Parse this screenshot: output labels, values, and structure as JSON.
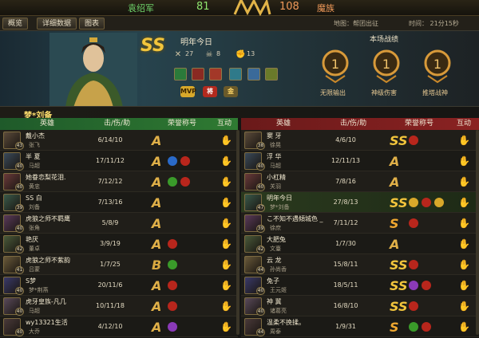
{
  "score": {
    "left_team": "袁绍军",
    "left_score": "81",
    "right_score": "108",
    "right_team": "魔族"
  },
  "tabs": [
    "概览",
    "详细数据",
    "图表"
  ],
  "map_info": "地图：帮团出征",
  "time_info": "时间：  21分15秒",
  "hero": {
    "rank": "SS",
    "name": "明年今日",
    "kills": "27",
    "deaths": "8",
    "assists": "13",
    "badges": [
      "MVP",
      "将",
      "金"
    ]
  },
  "result": {
    "title": "本场战绩",
    "medals": [
      "无限输出",
      "神级伤害",
      "推塔战神"
    ]
  },
  "player_tag": "梦*刘备",
  "headers": {
    "hero": "英雄",
    "kda": "击/伤/助",
    "honor": "荣誉称号",
    "interact": "互动"
  },
  "left_rows": [
    {
      "name": "戴小杰",
      "sub": "张飞",
      "level": "43",
      "kda": "6/14/10",
      "rank": "A",
      "honors": []
    },
    {
      "name": "半 夏",
      "sub": "马超",
      "level": "40",
      "kda": "17/11/12",
      "rank": "A",
      "honors": [
        "blue",
        "red"
      ]
    },
    {
      "name": "她眷恋梨花泪.",
      "sub": "黄忠",
      "level": "40",
      "kda": "7/12/12",
      "rank": "A",
      "honors": [
        "green",
        "red"
      ]
    },
    {
      "name": "SS 白",
      "sub": "刘备",
      "level": "39",
      "kda": "7/13/16",
      "rank": "A",
      "honors": []
    },
    {
      "name": "虎狼之师不羁鹰",
      "sub": "张角",
      "level": "40",
      "kda": "5/8/9",
      "rank": "A",
      "honors": []
    },
    {
      "name": "艳厌",
      "sub": "董卓",
      "level": "42",
      "kda": "3/9/19",
      "rank": "A",
      "honors": [
        "red"
      ]
    },
    {
      "name": "虎狼之师不紫韵",
      "sub": "吕蒙",
      "level": "41",
      "kda": "1/7/25",
      "rank": "B",
      "honors": [
        "green"
      ]
    },
    {
      "name": "S梦",
      "sub": "梦*荆燕",
      "level": "40",
      "kda": "20/11/6",
      "rank": "A",
      "honors": [
        "red"
      ]
    },
    {
      "name": "虎牙皇族-凡几",
      "sub": "马超",
      "level": "40",
      "kda": "10/11/18",
      "rank": "A",
      "honors": [
        "red"
      ]
    },
    {
      "name": "wy13321生活",
      "sub": "大乔",
      "level": "40",
      "kda": "4/12/10",
      "rank": "A",
      "honors": [
        "purple"
      ]
    }
  ],
  "right_rows": [
    {
      "name": "窦 牙",
      "sub": "徐晃",
      "level": "38",
      "kda": "4/6/10",
      "rank": "SS",
      "honors": [
        "red"
      ]
    },
    {
      "name": "浮 华",
      "sub": "马超",
      "level": "40",
      "kda": "12/11/13",
      "rank": "A",
      "honors": []
    },
    {
      "name": "小杠精",
      "sub": "关羽",
      "level": "40",
      "kda": "7/8/16",
      "rank": "A",
      "honors": []
    },
    {
      "name": "明年今日",
      "sub": "梦*刘备",
      "level": "47",
      "kda": "27/8/13",
      "rank": "SS",
      "honors": [
        "gold",
        "red",
        "gold"
      ]
    },
    {
      "name": "こ不知不遇傾城色 _",
      "sub": "徐庶",
      "level": "39",
      "kda": "7/11/12",
      "rank": "S",
      "honors": [
        "red"
      ]
    },
    {
      "name": "大肥兔",
      "sub": "文臺",
      "level": "42",
      "kda": "1/7/30",
      "rank": "A",
      "honors": []
    },
    {
      "name": "云 龙",
      "sub": "孙尚香",
      "level": "44",
      "kda": "15/8/11",
      "rank": "SS",
      "honors": [
        "red"
      ]
    },
    {
      "name": "兔子",
      "sub": "王元姬",
      "level": "40",
      "kda": "18/5/11",
      "rank": "SS",
      "honors": [
        "purple",
        "red"
      ]
    },
    {
      "name": "神 冀",
      "sub": "诸葛亮",
      "level": "40",
      "kda": "16/8/10",
      "rank": "SS",
      "honors": [
        "red"
      ]
    },
    {
      "name": "温柔不挽揉。",
      "sub": "周泰",
      "level": "44",
      "kda": "1/9/31",
      "rank": "S",
      "honors": [
        "green",
        "red"
      ]
    }
  ]
}
